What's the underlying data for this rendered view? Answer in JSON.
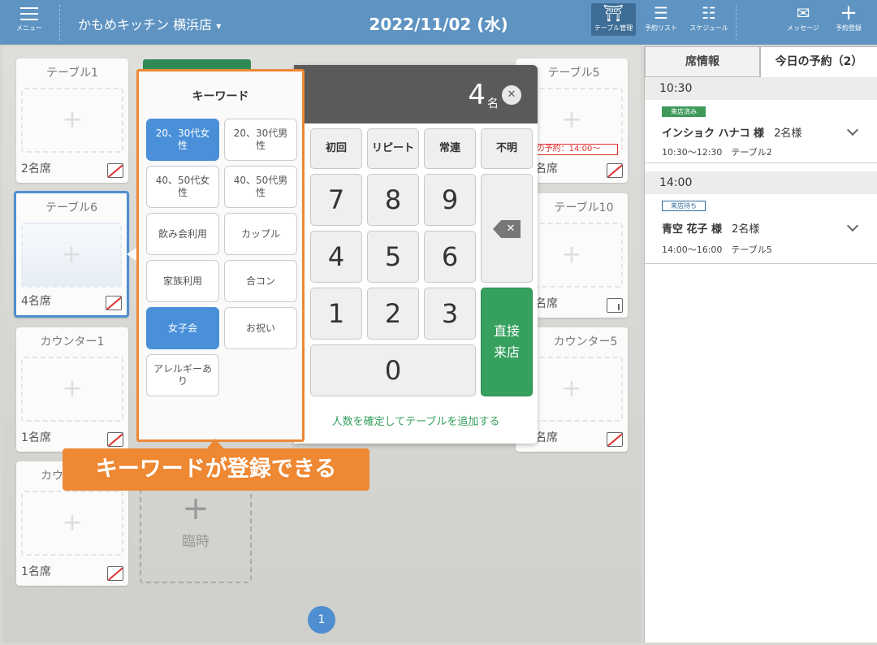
{
  "header": {
    "menu_label": "メニュー",
    "store_name": "かもめキッチン 横浜店",
    "store_caret": "▾",
    "date": "2022/11/02 (水)",
    "buttons": [
      {
        "label": "テーブル管理",
        "icon": "table-icon",
        "glyph": "⛩",
        "active": true
      },
      {
        "label": "予約リスト",
        "icon": "list-icon",
        "glyph": "☰",
        "active": false
      },
      {
        "label": "スケジュール",
        "icon": "schedule-icon",
        "glyph": "☷",
        "active": false
      },
      {
        "label": "メッセージ",
        "icon": "mail-icon",
        "glyph": "✉",
        "active": false
      },
      {
        "label": "予約登録",
        "icon": "plus-icon",
        "glyph": "+",
        "active": false
      }
    ]
  },
  "tables": [
    {
      "name": "テーブル1",
      "seats": "2名席",
      "smoking": false
    },
    {
      "name": "テーブル5",
      "seats": "名席",
      "smoking": false,
      "next_reservation": "次の予約：14:00〜"
    },
    {
      "name": "テーブル6",
      "seats": "4名席",
      "smoking": false,
      "selected": true
    },
    {
      "name": "テーブル10",
      "seats": "名席",
      "smoking": true
    },
    {
      "name": "カウンター1",
      "seats": "1名席",
      "smoking": false
    },
    {
      "name": "カウンター5",
      "seats": "名席",
      "smoking": false
    },
    {
      "name": "カウ",
      "seats": "1名席",
      "smoking": false
    }
  ],
  "temp_table": {
    "label": "臨時"
  },
  "pagination": {
    "current": "1"
  },
  "numpad": {
    "count": "4",
    "unit": "名",
    "close": "✕",
    "categories": [
      "初回",
      "リピート",
      "常連",
      "不明"
    ],
    "digits": [
      "7",
      "8",
      "9",
      "4",
      "5",
      "6",
      "1",
      "2",
      "3",
      "0"
    ],
    "backspace": "✕",
    "direct_line1": "直接",
    "direct_line2": "来店",
    "confirm_link": "人数を確定してテーブルを追加する"
  },
  "keyword_panel": {
    "title": "キーワード",
    "chips": [
      {
        "label": "20、30代女性",
        "on": true
      },
      {
        "label": "20、30代男性",
        "on": false
      },
      {
        "label": "40、50代女性",
        "on": false
      },
      {
        "label": "40、50代男性",
        "on": false
      },
      {
        "label": "飲み会利用",
        "on": false
      },
      {
        "label": "カップル",
        "on": false
      },
      {
        "label": "家族利用",
        "on": false
      },
      {
        "label": "合コン",
        "on": false
      },
      {
        "label": "女子会",
        "on": true
      },
      {
        "label": "お祝い",
        "on": false
      },
      {
        "label": "アレルギーあり",
        "on": false
      }
    ]
  },
  "callout": "キーワードが登録できる",
  "sidebar": {
    "tabs": [
      "席情報",
      "今日の予約（2）"
    ],
    "slots": [
      {
        "time": "10:30",
        "status": "来店済み",
        "status_type": "done",
        "guest": "インショク ハナコ 様",
        "count": "2名様",
        "detail": "10:30～12:30　テーブル2"
      },
      {
        "time": "14:00",
        "status": "来店待ち",
        "status_type": "wait",
        "guest": "青空 花子 様",
        "count": "2名様",
        "detail": "14:00～16:00　テーブル5"
      }
    ]
  },
  "colors": {
    "header": "#5e93c2",
    "accent": "#4a90d9",
    "orange": "#ee8833",
    "green": "#36a05e"
  }
}
